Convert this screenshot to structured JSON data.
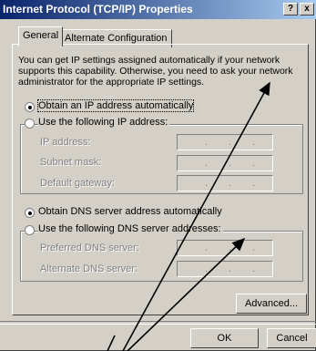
{
  "window": {
    "title": "Internet Protocol (TCP/IP) Properties",
    "help_button": "?",
    "close_button": "x"
  },
  "tabs": [
    {
      "label": "General",
      "active": true
    },
    {
      "label": "Alternate Configuration",
      "active": false
    }
  ],
  "description": "You can get IP settings assigned automatically if your network supports this capability. Otherwise, you need to ask your network administrator for the appropriate IP settings.",
  "ip_section": {
    "auto_option": "Obtain an IP address automatically",
    "manual_option": "Use the following IP address:",
    "selected": "auto",
    "fields": [
      {
        "label": "IP address:",
        "value": ""
      },
      {
        "label": "Subnet mask:",
        "value": ""
      },
      {
        "label": "Default gateway:",
        "value": ""
      }
    ]
  },
  "dns_section": {
    "auto_option": "Obtain DNS server address automatically",
    "manual_option": "Use the following DNS server addresses:",
    "selected": "auto",
    "fields": [
      {
        "label": "Preferred DNS server:",
        "value": ""
      },
      {
        "label": "Alternate DNS server:",
        "value": ""
      }
    ]
  },
  "buttons": {
    "advanced": "Advanced...",
    "ok": "OK",
    "cancel": "Cancel"
  },
  "colors": {
    "dialog_bg": "#d4d0c8",
    "title_start": "#0a246a",
    "title_end": "#a6caf0",
    "annotation_arrow": "#000000"
  }
}
